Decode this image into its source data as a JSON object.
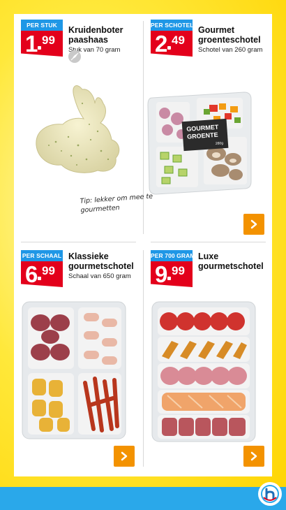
{
  "products": [
    {
      "price_label": "PER STUK",
      "price_main": "1",
      "price_cents": "99",
      "title": "Kruidenboter paashaas",
      "subtitle": "Stuk van 70 gram",
      "note": "Tip: lekker om mee te gourmetten",
      "icon": "vegetarian-icon"
    },
    {
      "price_label": "PER SCHOTEL",
      "price_main": "2",
      "price_cents": "49",
      "title": "Gourmet groenteschotel",
      "subtitle": "Schotel van 260 gram",
      "pack_text_1": "GOURMET",
      "pack_text_2": "GROENTE",
      "pack_weight": "260g"
    },
    {
      "price_label": "PER SCHAAL",
      "price_main": "6",
      "price_cents": "99",
      "title": "Klassieke gourmetschotel",
      "subtitle": "Schaal van 650 gram"
    },
    {
      "price_label": "PER 700 GRAM",
      "price_main": "9",
      "price_cents": "99",
      "title": "Luxe gourmetschotel",
      "subtitle": ""
    }
  ],
  "colors": {
    "price_red": "#e3001b",
    "label_blue": "#1f97e6",
    "button_orange": "#f39200",
    "bar_blue": "#2aa8ea",
    "background_yellow": "#ffe83a"
  },
  "icons": {
    "next": "chevron-right-icon",
    "logo": "hoogvliet-logo"
  }
}
